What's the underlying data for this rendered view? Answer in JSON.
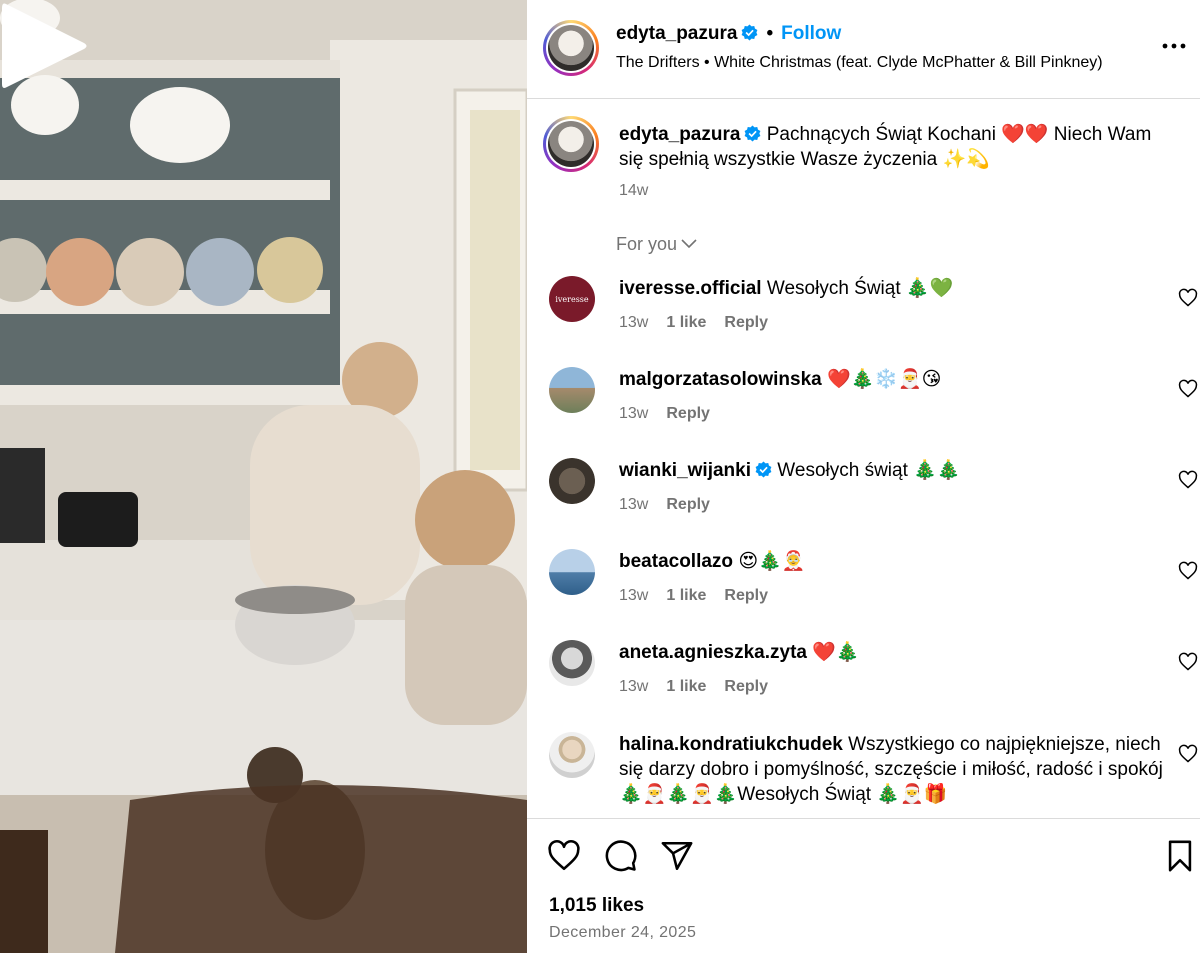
{
  "post": {
    "author": "edyta_pazura",
    "follow_label": "Follow",
    "separator": "•",
    "song": "The Drifters • White Christmas (feat. Clyde McPhatter & Bill Pinkney)",
    "caption": "Pachnących Świąt Kochani ❤️❤️ Niech Wam się spełnią wszystkie Wasze życzenia ✨💫",
    "caption_time": "14w",
    "for_you_label": "For you",
    "likes": "1,015 likes",
    "date": "December 24, 2025"
  },
  "comments": [
    {
      "user": "iveresse.official",
      "verified": false,
      "text": "Wesołych Świąt 🎄💚",
      "time": "13w",
      "likes": "1 like",
      "reply": "Reply",
      "avatar_label": "iveresse",
      "avatar_color": "#7a1a2a"
    },
    {
      "user": "malgorzatasolowinska",
      "verified": false,
      "text": "❤️🎄❄️🎅😘",
      "time": "13w",
      "likes": "",
      "reply": "Reply",
      "avatar_label": "",
      "avatar_color": "#7fa7c9"
    },
    {
      "user": "wianki_wijanki",
      "verified": true,
      "text": "Wesołych świąt 🎄🎄",
      "time": "13w",
      "likes": "",
      "reply": "Reply",
      "avatar_label": "",
      "avatar_color": "#4a4238"
    },
    {
      "user": "beatacollazo",
      "verified": false,
      "text": "😍🎄🤶",
      "time": "13w",
      "likes": "1 like",
      "reply": "Reply",
      "avatar_label": "",
      "avatar_color": "#6f9bc4"
    },
    {
      "user": "aneta.agnieszka.zyta",
      "verified": false,
      "text": "❤️🎄",
      "time": "13w",
      "likes": "1 like",
      "reply": "Reply",
      "avatar_label": "",
      "avatar_color": "#9a9a9a"
    },
    {
      "user": "halina.kondratiukchudek",
      "verified": false,
      "text": "Wszystkiego co najpiękniejsze, niech się darzy dobro i pomyślność, szczęście i miłość, radość i spokój 🎄🎅🎄🎅🎄Wesołych Świąt 🎄🎅🎁",
      "time": "",
      "likes": "",
      "reply": "",
      "avatar_label": "",
      "avatar_color": "#c9c2b8"
    }
  ],
  "colors": {
    "accent": "#0095f6",
    "secondary_text": "#737373",
    "border": "#dbdbdb",
    "verified": "#0095f6"
  },
  "icons": {
    "like": "heart-icon",
    "comment": "comment-icon",
    "share": "paper-plane-icon",
    "save": "bookmark-icon",
    "more": "more-icon",
    "play": "play-icon"
  }
}
